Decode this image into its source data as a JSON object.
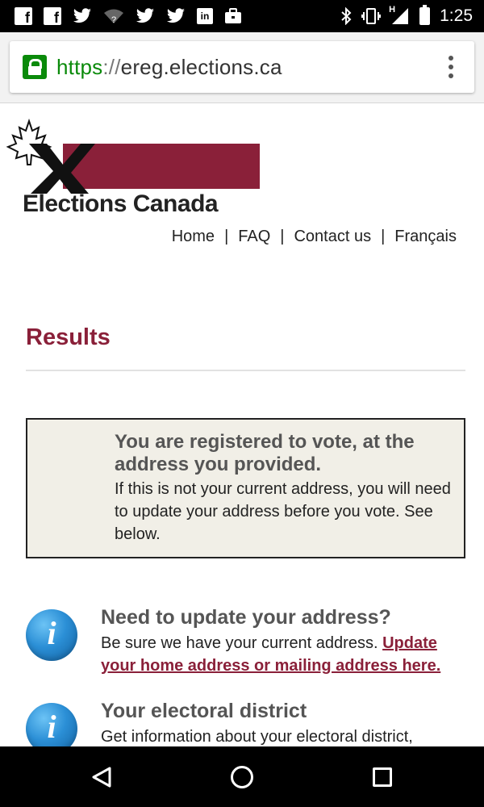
{
  "status_bar": {
    "time": "1:25",
    "left_icons": [
      "facebook-icon",
      "facebook-icon",
      "twitter-icon",
      "wifi-question-icon",
      "twitter-icon",
      "twitter-icon",
      "linkedin-icon",
      "briefcase-icon"
    ],
    "right_icons": [
      "bluetooth-icon",
      "vibrate-icon",
      "signal-h-icon",
      "battery-icon"
    ],
    "fb_letter": "f",
    "in_letters": "in",
    "h_letter": "H"
  },
  "browser": {
    "url_scheme": "https",
    "url_sep": "://",
    "url_host": "ereg.elections.ca"
  },
  "site": {
    "logo_text": "Elections Canada",
    "nav": {
      "home": "Home",
      "faq": "FAQ",
      "contact": "Contact us",
      "lang": "Français",
      "pipe": "|"
    }
  },
  "results": {
    "title": "Results",
    "notice_heading": "You are registered to vote, at the address you provided.",
    "notice_body": "If this is not your current address, you will need to update your address before you vote. See below."
  },
  "info_items": [
    {
      "icon_letter": "i",
      "title": "Need to update your address?",
      "body": "Be sure we have your current address. ",
      "link": "Update your home address or mailing address here."
    },
    {
      "icon_letter": "i",
      "title": "Your electoral district",
      "body": "Get information about your electoral district,"
    }
  ],
  "colors": {
    "brand": "#8a2039",
    "secure_green": "#0a8a0a",
    "notice_bg": "#f1efe7"
  }
}
